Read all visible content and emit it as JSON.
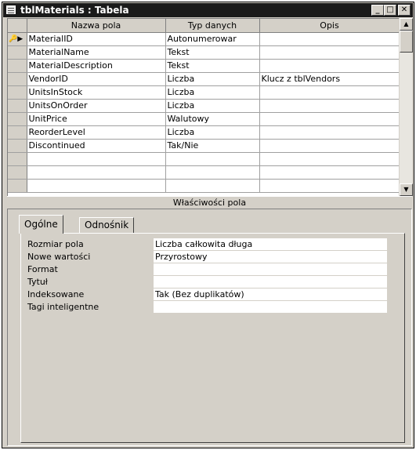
{
  "window": {
    "title": "tblMaterials : Tabela"
  },
  "grid": {
    "headers": [
      "Nazwa pola",
      "Typ danych",
      "Opis"
    ],
    "rows": [
      {
        "name": "MaterialID",
        "type": "Autonumerowar",
        "desc": ""
      },
      {
        "name": "MaterialName",
        "type": "Tekst",
        "desc": ""
      },
      {
        "name": "MaterialDescription",
        "type": "Tekst",
        "desc": ""
      },
      {
        "name": "VendorID",
        "type": "Liczba",
        "desc": "Klucz z tblVendors"
      },
      {
        "name": "UnitsInStock",
        "type": "Liczba",
        "desc": ""
      },
      {
        "name": "UnitsOnOrder",
        "type": "Liczba",
        "desc": ""
      },
      {
        "name": "UnitPrice",
        "type": "Walutowy",
        "desc": ""
      },
      {
        "name": "ReorderLevel",
        "type": "Liczba",
        "desc": ""
      },
      {
        "name": "Discontinued",
        "type": "Tak/Nie",
        "desc": ""
      }
    ]
  },
  "properties": {
    "section_label": "Właściwości pola",
    "tabs": [
      "Ogólne",
      "Odnośnik"
    ],
    "rows": [
      {
        "label": "Rozmiar pola",
        "value": "Liczba całkowita długa"
      },
      {
        "label": "Nowe wartości",
        "value": "Przyrostowy"
      },
      {
        "label": "Format",
        "value": ""
      },
      {
        "label": "Tytuł",
        "value": ""
      },
      {
        "label": "Indeksowane",
        "value": "Tak (Bez duplikatów)"
      },
      {
        "label": "Tagi inteligentne",
        "value": ""
      }
    ]
  }
}
